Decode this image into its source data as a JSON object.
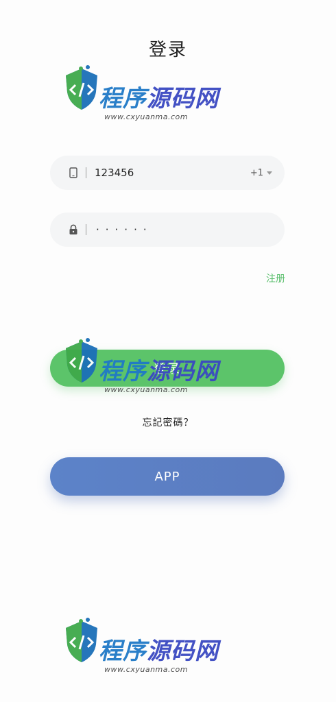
{
  "header": {
    "title": "登录"
  },
  "phone": {
    "value": "123456",
    "country_code": "+1"
  },
  "password": {
    "masked_value": "······"
  },
  "links": {
    "register": "注册",
    "forgot": "忘記密碼？"
  },
  "buttons": {
    "login": "登录",
    "app": "APP"
  },
  "watermark": {
    "brand_part1": "程序",
    "brand_part2": "源码网",
    "url": "www.cxyuanma.com"
  },
  "colors": {
    "accent_green": "#5cc46a",
    "app_blue": "#5b7fc4",
    "register_green": "#5cbf6e"
  },
  "icons": {
    "phone": "phone-icon",
    "lock": "lock-icon",
    "dropdown": "chevron-down-icon",
    "watermark": "shield-code-icon"
  }
}
